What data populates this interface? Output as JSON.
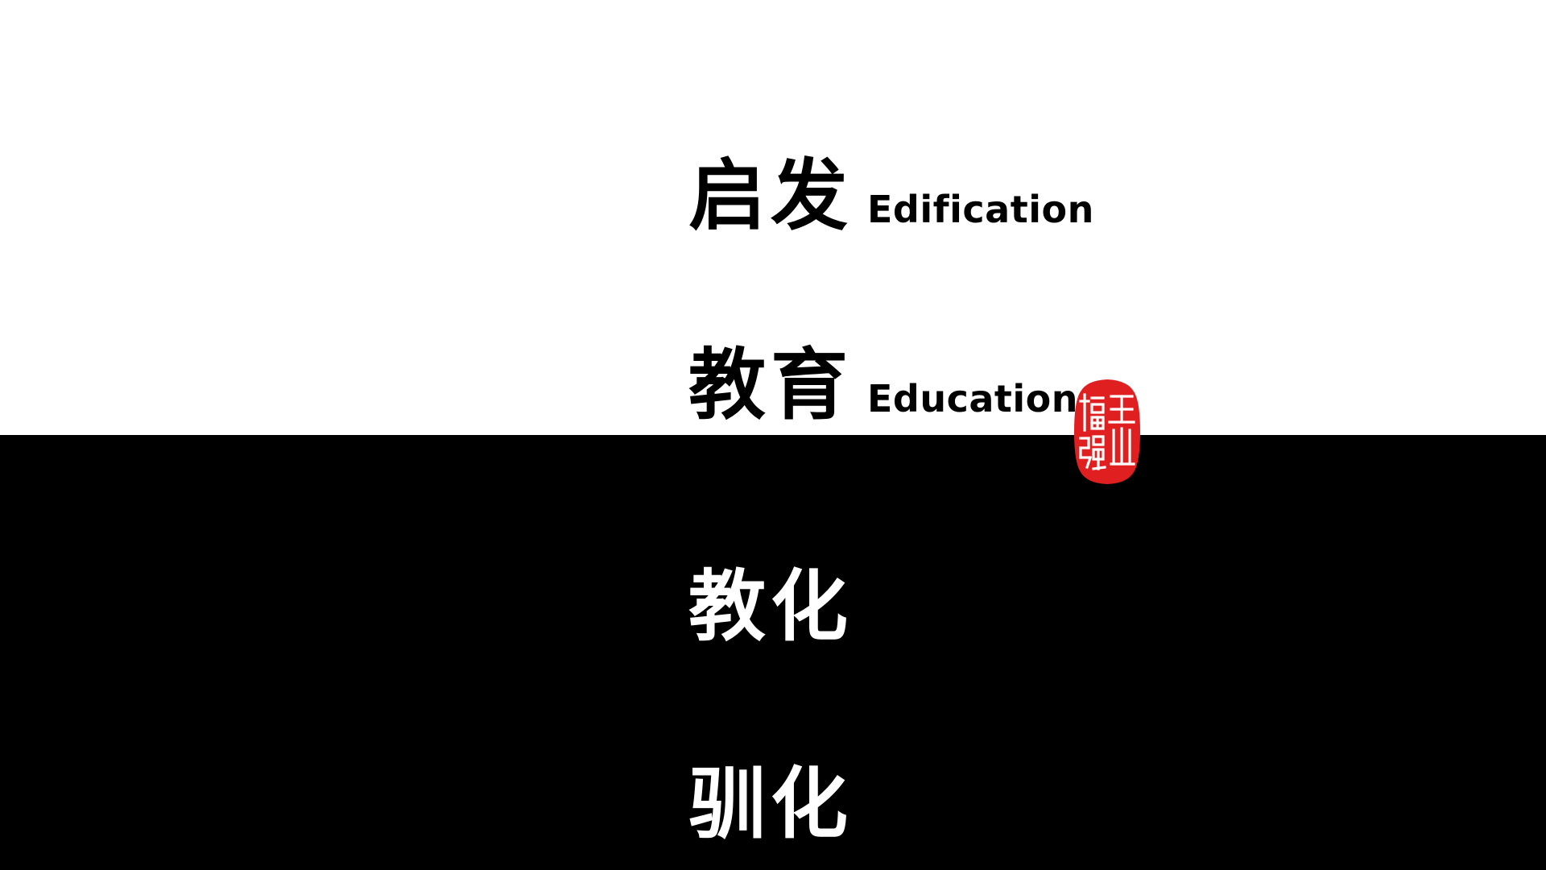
{
  "terms": [
    {
      "chinese": "启发",
      "english": "Edification"
    },
    {
      "chinese": "教育",
      "english": "Education"
    },
    {
      "chinese": "教化",
      "english": ""
    },
    {
      "chinese": "驯化",
      "english": ""
    }
  ],
  "seal": {
    "text": "王福强",
    "color": "#e02020"
  },
  "colors": {
    "top_background": "#ffffff",
    "bottom_background": "#000000",
    "text_on_white": "#000000",
    "text_on_black": "#ffffff"
  }
}
